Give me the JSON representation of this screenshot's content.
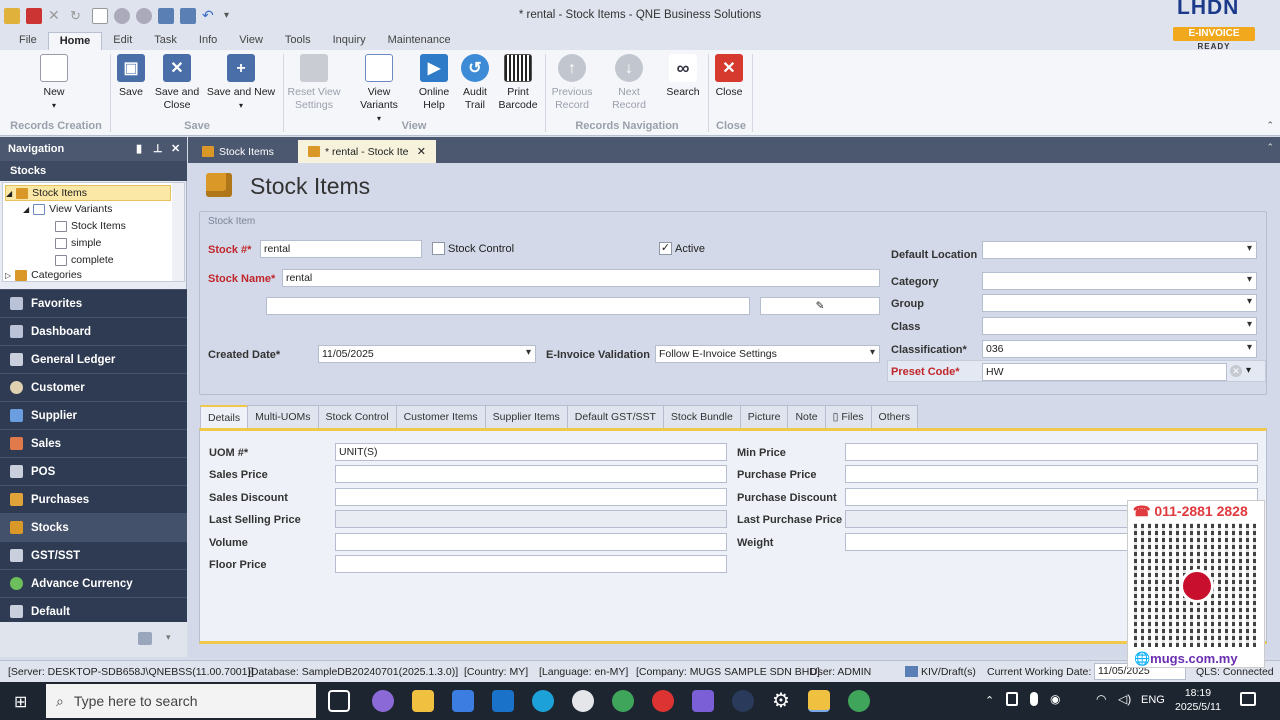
{
  "window": {
    "title": "* rental - Stock Items - QNE Business Solutions"
  },
  "badge": {
    "brand": "LHDN",
    "tag": "E-INVOICE",
    "sub": "READY"
  },
  "ribbon_tabs": [
    "File",
    "Home",
    "Edit",
    "Task",
    "Info",
    "View",
    "Tools",
    "Inquiry",
    "Maintenance"
  ],
  "ribbon": {
    "buttons": {
      "new": "New",
      "save": "Save",
      "save_close": "Save and Close",
      "save_new": "Save and New",
      "reset": "Reset View Settings",
      "view_variants": "View Variants",
      "online_help": "Online Help",
      "audit": "Audit Trail",
      "barcode": "Print Barcode",
      "prev": "Previous Record",
      "next": "Next Record",
      "search": "Search",
      "close": "Close"
    },
    "groups": {
      "records_creation": "Records Creation",
      "save": "Save",
      "view": "View",
      "records_nav": "Records Navigation",
      "close": "Close"
    }
  },
  "navigation": {
    "title": "Navigation",
    "section": "Stocks",
    "tree": {
      "stock_items": "Stock Items",
      "view_variants": "View Variants",
      "v1": "Stock Items",
      "v2": "simple",
      "v3": "complete",
      "categories": "Categories"
    },
    "items": [
      "Favorites",
      "Dashboard",
      "General Ledger",
      "Customer",
      "Supplier",
      "Sales",
      "POS",
      "Purchases",
      "Stocks",
      "GST/SST",
      "Advance Currency",
      "Default"
    ]
  },
  "doc_tabs": {
    "t1": "Stock Items",
    "t2": "* rental - Stock Ite"
  },
  "page": {
    "title": "Stock Items",
    "group_legend": "Stock Item"
  },
  "form": {
    "stock_no_label": "Stock #*",
    "stock_no": "rental",
    "stock_control_label": "Stock Control",
    "active_label": "Active",
    "stock_name_label": "Stock Name*",
    "stock_name": "rental",
    "created_label": "Created Date*",
    "created": "11/05/2025",
    "einv_label": "E-Invoice Validation",
    "einv": "Follow E-Invoice Settings",
    "default_location_label": "Default Location",
    "category_label": "Category",
    "group_label": "Group",
    "class_label": "Class",
    "classification_label": "Classification*",
    "classification": "036",
    "preset_label": "Preset Code*",
    "preset": "HW"
  },
  "subtabs": [
    "Details",
    "Multi-UOMs",
    "Stock Control",
    "Customer Items",
    "Supplier Items",
    "Default GST/SST",
    "Stock Bundle",
    "Picture",
    "Note",
    "Files",
    "Others"
  ],
  "details": {
    "uom_label": "UOM #*",
    "uom": "UNIT(S)",
    "sales_price": "Sales Price",
    "sales_discount": "Sales Discount",
    "last_selling": "Last Selling Price",
    "volume": "Volume",
    "floor_price": "Floor Price",
    "min_price": "Min Price",
    "purchase_price": "Purchase Price",
    "purchase_discount": "Purchase Discount",
    "last_purchase": "Last Purchase Price",
    "weight": "Weight"
  },
  "status": {
    "server": "[Server: DESKTOP-SDB658J\\QNEBSS(11.00.7001)]",
    "database": "[Database: SampleDB20240701(2025.1.3.0)]",
    "country": "[Country: MY]",
    "language": "[Language: en-MY]",
    "company": "[Company: MUGS SAMPLE SDN BHD]",
    "user": "User: ADMIN",
    "kiv": "KIV/Draft(s)",
    "cwd_label": "Current Working Date:",
    "cwd": "11/05/2025",
    "qls": "QLS: Connected"
  },
  "taskbar": {
    "search": "Type here to search",
    "lang": "ENG",
    "time": "18:19",
    "date": "2025/5/11"
  },
  "ad": {
    "phone": "☎ 011-2881 2828",
    "site": "🌐mugs.com.my"
  }
}
